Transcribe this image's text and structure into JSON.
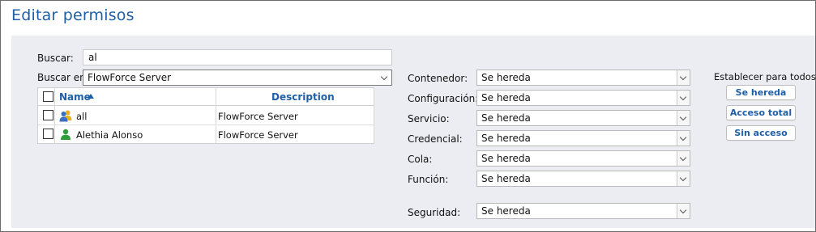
{
  "page_title": "Editar permisos",
  "search": {
    "label": "Buscar:",
    "value": "al",
    "scope_label": "Buscar en:",
    "scope_value": "FlowForce Server"
  },
  "table": {
    "columns": {
      "name": "Name",
      "description": "Description"
    },
    "rows": [
      {
        "name": "all",
        "description": "FlowForce Server",
        "icon": "group-icon"
      },
      {
        "name": "Alethia Alonso",
        "description": "FlowForce Server",
        "icon": "user-icon"
      }
    ]
  },
  "permissions": [
    {
      "label": "Contenedor:",
      "value": "Se hereda"
    },
    {
      "label": "Configuración:",
      "value": "Se hereda"
    },
    {
      "label": "Servicio:",
      "value": "Se hereda"
    },
    {
      "label": "Credencial:",
      "value": "Se hereda"
    },
    {
      "label": "Cola:",
      "value": "Se hereda"
    },
    {
      "label": "Función:",
      "value": "Se hereda"
    },
    {
      "label": "Seguridad:",
      "value": "Se hereda"
    }
  ],
  "set_all": {
    "label": "Establecer para todos:",
    "buttons": [
      "Se hereda",
      "Acceso total",
      "Sin acceso"
    ]
  },
  "colors": {
    "accent": "#1f5fa6",
    "panel_bg": "#ecedf2",
    "user_green": "#2e9e3a",
    "group_blue": "#3a6fc4",
    "group_yellow": "#e8b21f"
  }
}
